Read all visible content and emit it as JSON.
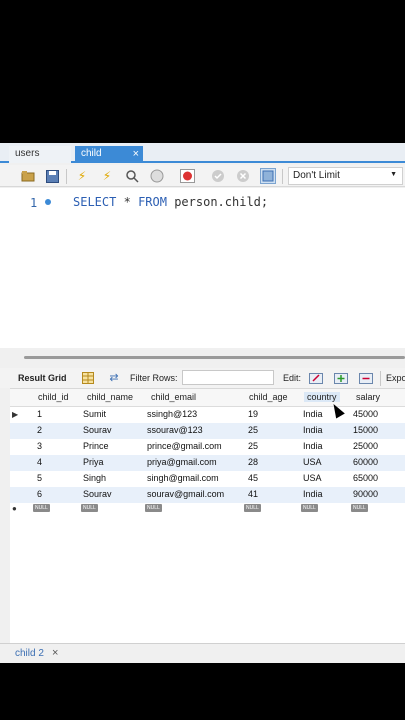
{
  "tabs": [
    {
      "label": "users"
    },
    {
      "label": "child",
      "close": "×"
    }
  ],
  "toolbar": {
    "limit_value": "Don't Limit"
  },
  "editor": {
    "line_number": "1",
    "keyword_select": "SELECT",
    "star": "*",
    "keyword_from": "FROM",
    "table": "person.child;"
  },
  "result": {
    "grid_label": "Result Grid",
    "filter_label": "Filter Rows:",
    "filter_value": "",
    "edit_label": "Edit:",
    "export_label": "Expo"
  },
  "grid": {
    "columns": [
      "child_id",
      "child_name",
      "child_email",
      "child_age",
      "country",
      "salary"
    ],
    "rows": [
      [
        "1",
        "Sumit",
        "ssingh@123",
        "19",
        "India",
        "45000"
      ],
      [
        "2",
        "Sourav",
        "ssourav@123",
        "25",
        "India",
        "15000"
      ],
      [
        "3",
        "Prince",
        "prince@gmail.com",
        "25",
        "India",
        "25000"
      ],
      [
        "4",
        "Priya",
        "priya@gmail.com",
        "28",
        "USA",
        "60000"
      ],
      [
        "5",
        "Singh",
        "singh@gmail.com",
        "45",
        "USA",
        "65000"
      ],
      [
        "6",
        "Sourav",
        "sourav@gmail.com",
        "41",
        "India",
        "90000"
      ]
    ],
    "null_label": "NULL"
  },
  "bottom_tab": {
    "label": "child 2",
    "close": "×"
  }
}
